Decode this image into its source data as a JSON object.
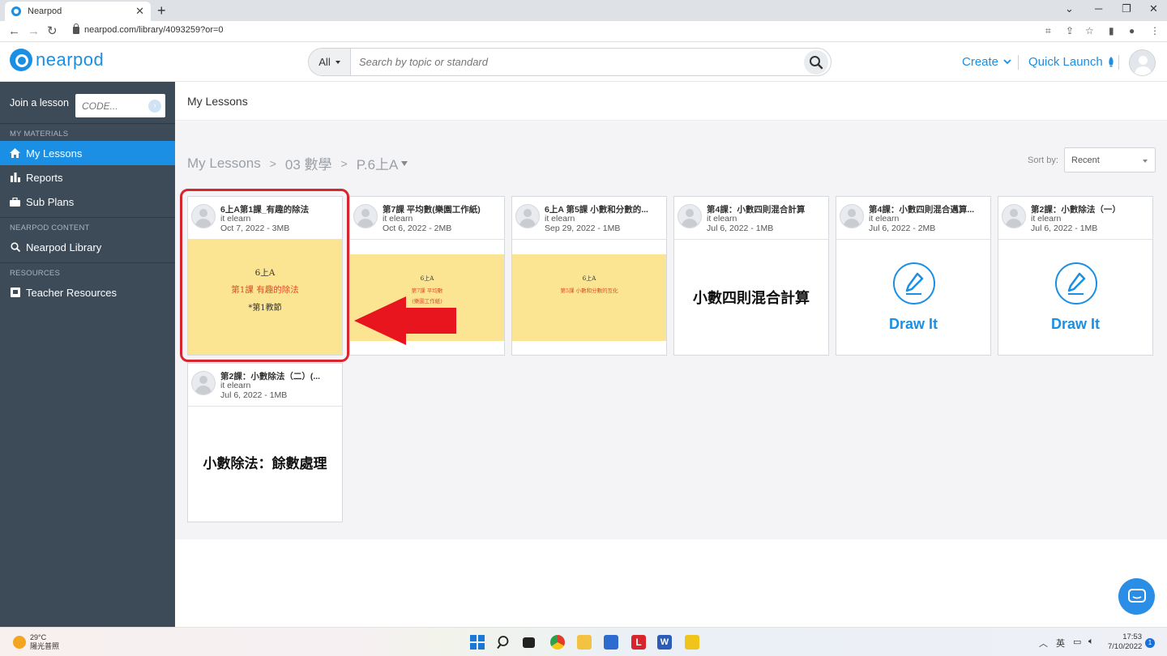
{
  "browser": {
    "tab_title": "Nearpod",
    "tab_close": "✕",
    "new_tab": "+",
    "url": "nearpod.com/library/4093259?or=0"
  },
  "header": {
    "logo_text": "nearpod",
    "search_scope": "All",
    "search_placeholder": "Search by topic or standard",
    "create_label": "Create",
    "quick_launch_label": "Quick Launch"
  },
  "sidebar": {
    "join_label": "Join a lesson",
    "code_placeholder": "CODE...",
    "sections": [
      {
        "label": "MY MATERIALS"
      },
      {
        "label": "NEARPOD CONTENT"
      },
      {
        "label": "RESOURCES"
      }
    ],
    "items": [
      {
        "label": "My Lessons",
        "active": true,
        "icon": "home-icon"
      },
      {
        "label": "Reports",
        "icon": "bar-chart-icon"
      },
      {
        "label": "Sub Plans",
        "icon": "briefcase-icon"
      },
      {
        "label": "Nearpod Library",
        "icon": "search-icon"
      },
      {
        "label": "Teacher Resources",
        "icon": "presentation-icon"
      }
    ]
  },
  "main": {
    "page_title": "My Lessons",
    "breadcrumb": [
      {
        "label": "My Lessons"
      },
      {
        "label": ">"
      },
      {
        "label": "03 數學"
      },
      {
        "label": ">"
      },
      {
        "label": "P.6上A"
      }
    ],
    "sort_label": "Sort by:",
    "sort_value": "Recent"
  },
  "lessons": [
    {
      "title": "6上A第1課_有趣的除法",
      "author": "it elearn",
      "meta": "Oct 7, 2022 - 3MB",
      "thumb_type": "slide",
      "slide_lines": [
        "6上A",
        "第1課 有趣的除法",
        "*第1教節"
      ]
    },
    {
      "title": "第7課 平均數(樂園工作紙)",
      "author": "it elearn",
      "meta": "Oct 6, 2022 - 2MB",
      "thumb_type": "slide",
      "slide_lines": [
        "6上A",
        "第7課 平均數",
        "(樂園工作紙)"
      ]
    },
    {
      "title": "6上A 第5課 小數和分數的...",
      "author": "it elearn",
      "meta": "Sep 29, 2022 - 1MB",
      "thumb_type": "slide",
      "slide_lines": [
        "6上A",
        "第5課 小數和分數的互化"
      ]
    },
    {
      "title": "第4課：小數四則混合計算",
      "author": "it elearn",
      "meta": "Jul 6, 2022 - 1MB",
      "thumb_type": "text",
      "thumb_text": "小數四則混合計算"
    },
    {
      "title": "第4課：小數四則混合邁算...",
      "author": "it elearn",
      "meta": "Jul 6, 2022 - 2MB",
      "thumb_type": "drawit",
      "thumb_text": "Draw It"
    },
    {
      "title": "第2課：小數除法（一）",
      "author": "it elearn",
      "meta": "Jul 6, 2022 - 1MB",
      "thumb_type": "drawit",
      "thumb_text": "Draw It"
    },
    {
      "title": "第2課：小數除法（二）(...",
      "author": "it elearn",
      "meta": "Jul 6, 2022 - 1MB",
      "thumb_type": "text",
      "thumb_text": "小數除法：餘數處理"
    }
  ],
  "taskbar": {
    "temp": "29°C",
    "weather": "陽光普照",
    "lang": "英",
    "time": "17:53",
    "date": "7/10/2022",
    "notif_count": "1"
  },
  "colors": {
    "brand": "#1a8fe3",
    "sidebar": "#3d4a57",
    "slide_yellow": "#fbe593",
    "highlight": "#d8262f"
  }
}
